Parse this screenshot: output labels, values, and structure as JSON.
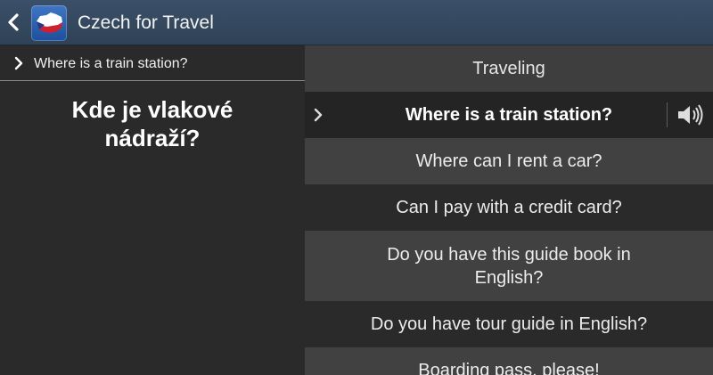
{
  "app": {
    "title": "Czech for Travel",
    "icon": "czech-flag-map-icon",
    "colors": {
      "actionbar": "#34495f",
      "flag_white": "#ffffff",
      "flag_red": "#d0202e",
      "flag_blue": "#1e3a8a"
    }
  },
  "left": {
    "breadcrumb_label": "Where is a train station?",
    "translation_line1": "Kde je vlakové",
    "translation_line2": "nádraží?"
  },
  "right": {
    "category": "Traveling",
    "phrases": [
      {
        "line1": "Where is a train station?",
        "line2": ""
      },
      {
        "line1": "Where can I rent a car?",
        "line2": ""
      },
      {
        "line1": "Can I pay with a credit card?",
        "line2": ""
      },
      {
        "line1": "Do you have this guide book in",
        "line2": "English?"
      },
      {
        "line1": "Do you have tour guide in English?",
        "line2": ""
      },
      {
        "line1": "Boarding pass, please!",
        "line2": ""
      }
    ]
  }
}
